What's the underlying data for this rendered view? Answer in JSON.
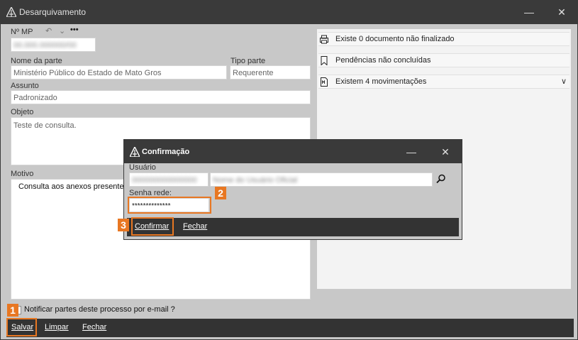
{
  "window": {
    "title": "Desarquivamento",
    "minimize": "—",
    "close": "✕"
  },
  "form": {
    "mp_label": "Nº MP",
    "mp_value": "00.000.000000/00",
    "more": "•••",
    "nome_parte_label": "Nome da parte",
    "nome_parte_value": "Ministério Público do Estado de Mato Gros",
    "tipo_parte_label": "Tipo parte",
    "tipo_parte_value": "Requerente",
    "assunto_label": "Assunto",
    "assunto_value": "Padronizado",
    "objeto_label": "Objeto",
    "objeto_value": "Teste de consulta.",
    "motivo_label": "Motivo",
    "motivo_value": "Consulta aos anexos presente"
  },
  "right_panel": {
    "rows": [
      {
        "icon": "printer-icon",
        "text": "Existe 0 documento não finalizado"
      },
      {
        "icon": "bookmark-icon",
        "text": "Pendências não concluídas"
      },
      {
        "icon": "document-icon",
        "text": "Existem 4 movimentações"
      }
    ]
  },
  "notify_label": "Notificar partes deste processo por e-mail ?",
  "bottom_buttons": {
    "salvar": "Salvar",
    "limpar": "Limpar",
    "fechar": "Fechar"
  },
  "dialog": {
    "title": "Confirmação",
    "minimize": "—",
    "close": "✕",
    "usuario_label": "Usuário",
    "usuario_id": "000000000000000",
    "usuario_name": "Nome do Usuário Oficial",
    "senha_label": "Senha rede:",
    "senha_value": "**************",
    "confirmar": "Confirmar",
    "fechar": "Fechar"
  },
  "badges": [
    "1",
    "2",
    "3"
  ],
  "colors": {
    "titlebar": "#3a3a3a",
    "highlight": "#e87722",
    "panel": "#f3f3f3"
  }
}
